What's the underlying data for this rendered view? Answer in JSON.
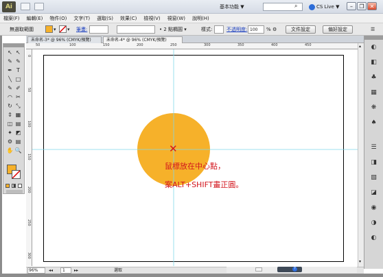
{
  "titlebar": {
    "app_logo": "Ai",
    "workspace": "基本功能 ▼",
    "cs_live": "CS Live ▼",
    "win_minimize": "–",
    "win_restore": "❐",
    "win_close": "✕"
  },
  "menu": [
    "檔案(F)",
    "編輯(E)",
    "物件(O)",
    "文字(T)",
    "選取(S)",
    "效果(C)",
    "檢視(V)",
    "視窗(W)",
    "說明(H)"
  ],
  "control": {
    "selection_label": "無選取範圍",
    "stroke_label": "筆畫:",
    "brush_value": "2 點橢圓",
    "style_label": "樣式:",
    "opacity_label": "不透明度:",
    "opacity_value": "100",
    "percent": "%",
    "doc_setup": "文件設定",
    "preferences": "偏好設定"
  },
  "tabs": [
    "未命名-3* @ 96% (CMYK/預覽)",
    "未命名-4* @ 96% (CMYK/預覽)"
  ],
  "ruler": {
    "h": [
      "50",
      "100",
      "150",
      "200",
      "250",
      "300",
      "350",
      "400",
      "450"
    ],
    "v": [
      "0",
      "50",
      "100",
      "150",
      "200",
      "250",
      "300"
    ]
  },
  "status": {
    "zoom": "96%",
    "page": "1",
    "mode": "選取"
  },
  "colors": {
    "circle": "#f6b12a",
    "guide": "#7fd8ea",
    "annotation": "#d2141c",
    "fill_swatch": "#f6b12a"
  },
  "annotation": {
    "line1": "鼠標放在中心點，",
    "line2": "案ALT+SHIFT畫正圓。",
    "center_mark": "✕"
  },
  "tools": [
    "↖",
    "↖",
    "✎",
    "✎",
    "✒",
    "T",
    "╲",
    "□",
    "✎",
    "✐",
    "◠",
    "✂",
    "↻",
    "⤡",
    "⇕",
    "▦",
    "◫",
    "▤",
    "✦",
    "◩",
    "⚙",
    "▤",
    "✋",
    "🔍"
  ],
  "dock": [
    "◐",
    "◧",
    "♣",
    "▦",
    "❋",
    "♠",
    "☰",
    "◨",
    "▧",
    "◪",
    "◉",
    "◑",
    "◐"
  ]
}
